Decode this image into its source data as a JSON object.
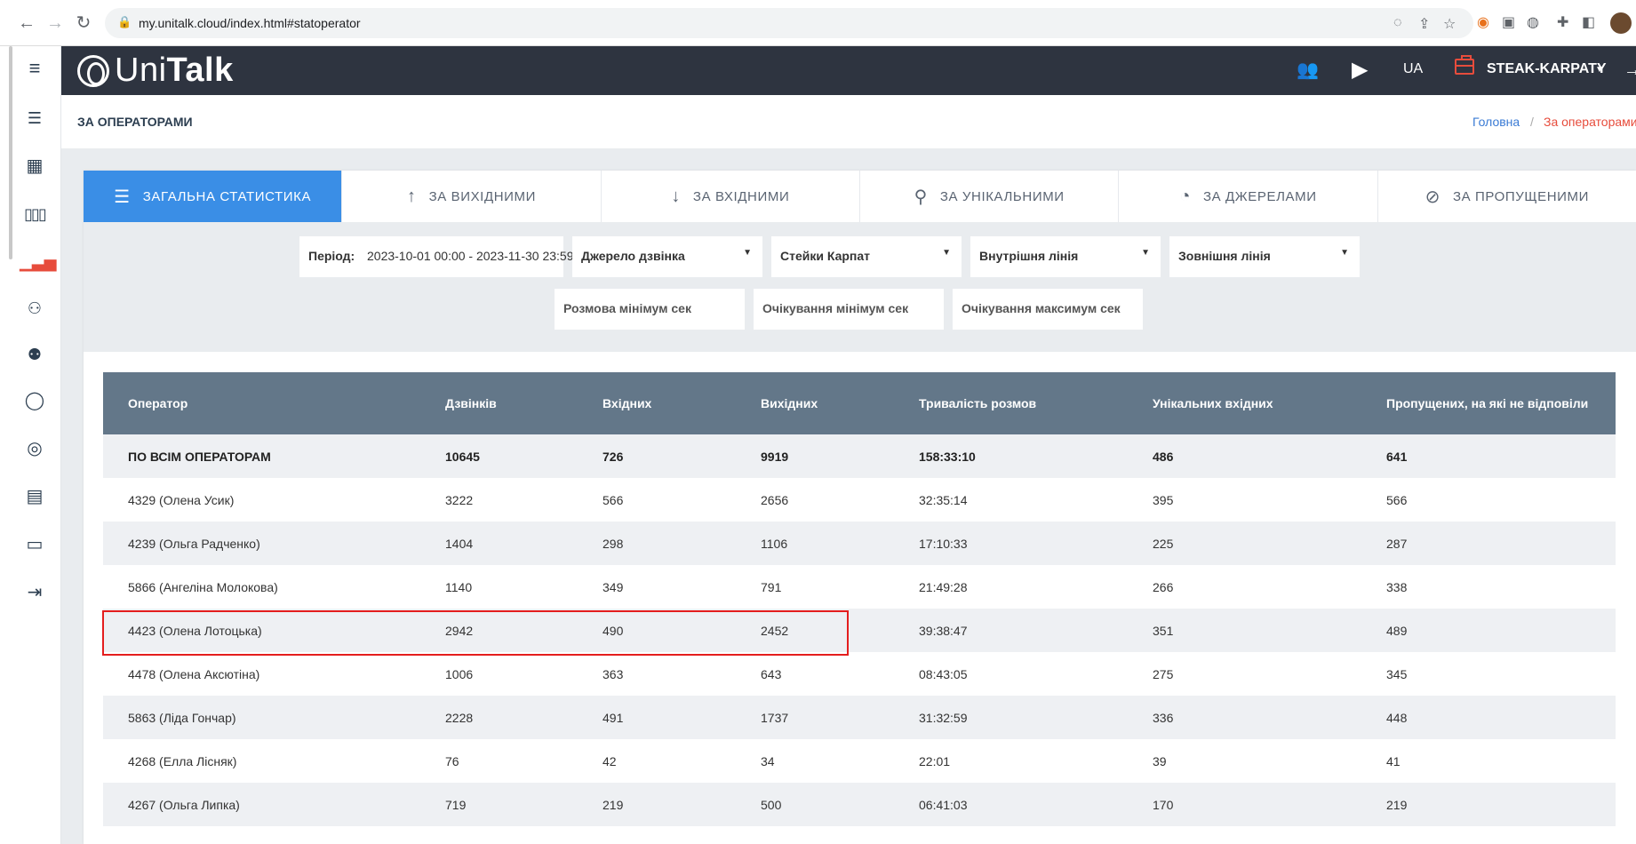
{
  "browser": {
    "url": "my.unitalk.cloud/index.html#statoperator"
  },
  "header": {
    "logo_light": "Uni",
    "logo_bold": "Talk",
    "language": "UA",
    "company": "STEAK-KARPATY",
    "accent": "#e74c3c"
  },
  "breadcrumb": {
    "page_title": "ЗА ОПЕРАТОРАМИ",
    "home": "Головна",
    "separator": "/",
    "current": "За операторами"
  },
  "tabs": [
    {
      "label": "ЗАГАЛЬНА СТАТИСТИКА",
      "icon": "list-icon",
      "active": true
    },
    {
      "label": "ЗА ВИХІДНИМИ",
      "icon": "arrow-up-icon",
      "active": false
    },
    {
      "label": "ЗА ВХІДНИМИ",
      "icon": "arrow-down-icon",
      "active": false
    },
    {
      "label": "ЗА УНІКАЛЬНИМИ",
      "icon": "user-icon",
      "active": false
    },
    {
      "label": "ЗА ДЖЕРЕЛАМИ",
      "icon": "pie-chart-icon",
      "active": false
    },
    {
      "label": "ЗА ПРОПУЩЕНИМИ",
      "icon": "ban-icon",
      "active": false
    }
  ],
  "filters": {
    "period_label": "Період:",
    "period_value": "2023-10-01 00:00 - 2023-11-30 23:59",
    "source": "Джерело дзвінка",
    "group": "Стейки Карпат",
    "internal_line": "Внутрішня лінія",
    "external_line": "Зовнішня лінія",
    "talk_min_placeholder": "Розмова мінімум сек",
    "wait_min_placeholder": "Очікування мінімум сек",
    "wait_max_placeholder": "Очікування максимум сек"
  },
  "table": {
    "columns": [
      "Оператор",
      "Дзвінків",
      "Вхідних",
      "Вихідних",
      "Тривалість розмов",
      "Унікальних вхідних",
      "Пропущених, на які не відповіли"
    ],
    "total": [
      "ПО ВСІМ ОПЕРАТОРАМ",
      "10645",
      "726",
      "9919",
      "158:33:10",
      "486",
      "641"
    ],
    "rows": [
      [
        "4329 (Олена Усик)",
        "3222",
        "566",
        "2656",
        "32:35:14",
        "395",
        "566"
      ],
      [
        "4239 (Ольга Радченко)",
        "1404",
        "298",
        "1106",
        "17:10:33",
        "225",
        "287"
      ],
      [
        "5866 (Ангеліна Молокова)",
        "1140",
        "349",
        "791",
        "21:49:28",
        "266",
        "338"
      ],
      [
        "4423 (Олена Лотоцька)",
        "2942",
        "490",
        "2452",
        "39:38:47",
        "351",
        "489"
      ],
      [
        "4478 (Олена Аксютіна)",
        "1006",
        "363",
        "643",
        "08:43:05",
        "275",
        "345"
      ],
      [
        "5863 (Ліда Гончар)",
        "2228",
        "491",
        "1737",
        "31:32:59",
        "336",
        "448"
      ],
      [
        "4268 (Елла Лісняк)",
        "76",
        "42",
        "34",
        "22:01",
        "39",
        "41"
      ],
      [
        "4267 (Ольга Липка)",
        "719",
        "219",
        "500",
        "06:41:03",
        "170",
        "219"
      ]
    ]
  }
}
